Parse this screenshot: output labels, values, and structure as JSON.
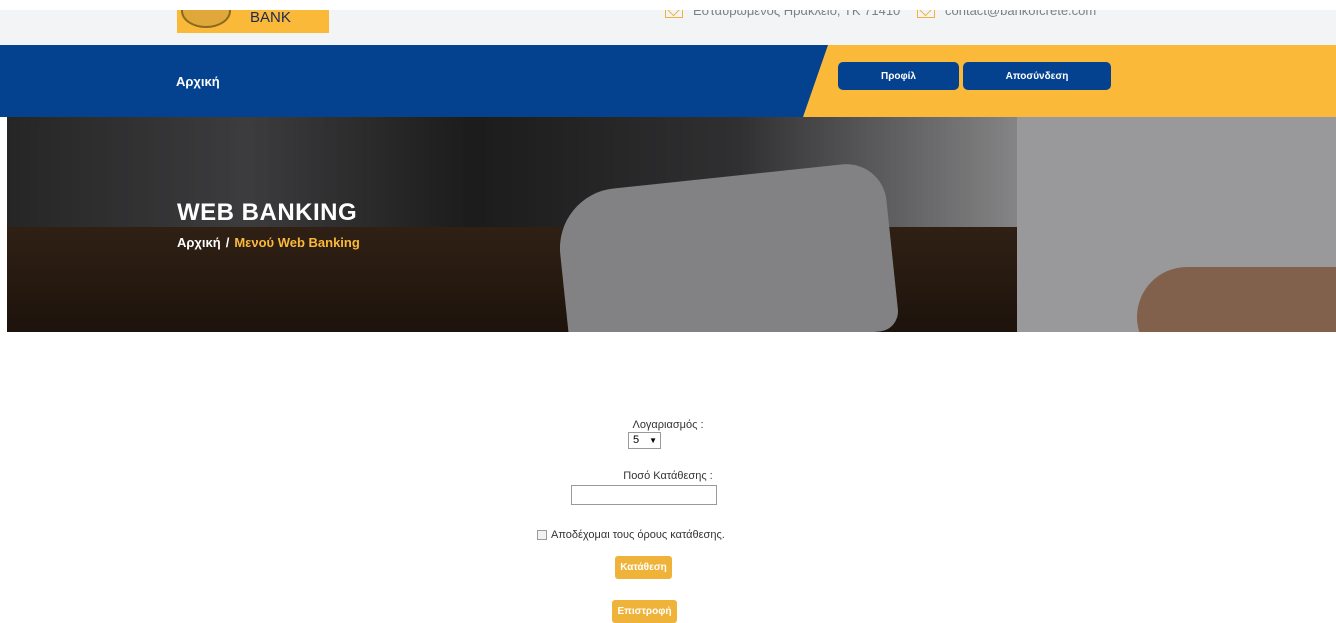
{
  "header": {
    "logo_text": "BANK",
    "address": "Εσταυρωμένος Ηράκλειο, ΤΚ 71410",
    "email": "contact@bankofcrete.com"
  },
  "nav": {
    "home_label": "Αρχική",
    "profile_label": "Προφίλ",
    "logout_label": "Αποσύνδεση"
  },
  "hero": {
    "title": "WEB BANKING",
    "breadcrumb_home": "Αρχική",
    "breadcrumb_sep": "/",
    "breadcrumb_current": "Μενού Web Banking"
  },
  "form": {
    "account_label": "Λογαριασμός :",
    "account_value": "5",
    "amount_label": "Ποσό Κατάθεσης :",
    "amount_value": "",
    "terms_label": "Αποδέχομαι τους όρους κατάθεσης.",
    "deposit_label": "Κατάθεση",
    "back_label": "Επιστροφή"
  },
  "colors": {
    "brand_blue": "#04418f",
    "brand_yellow": "#fbb93a",
    "button_yellow": "#f0b33a"
  }
}
